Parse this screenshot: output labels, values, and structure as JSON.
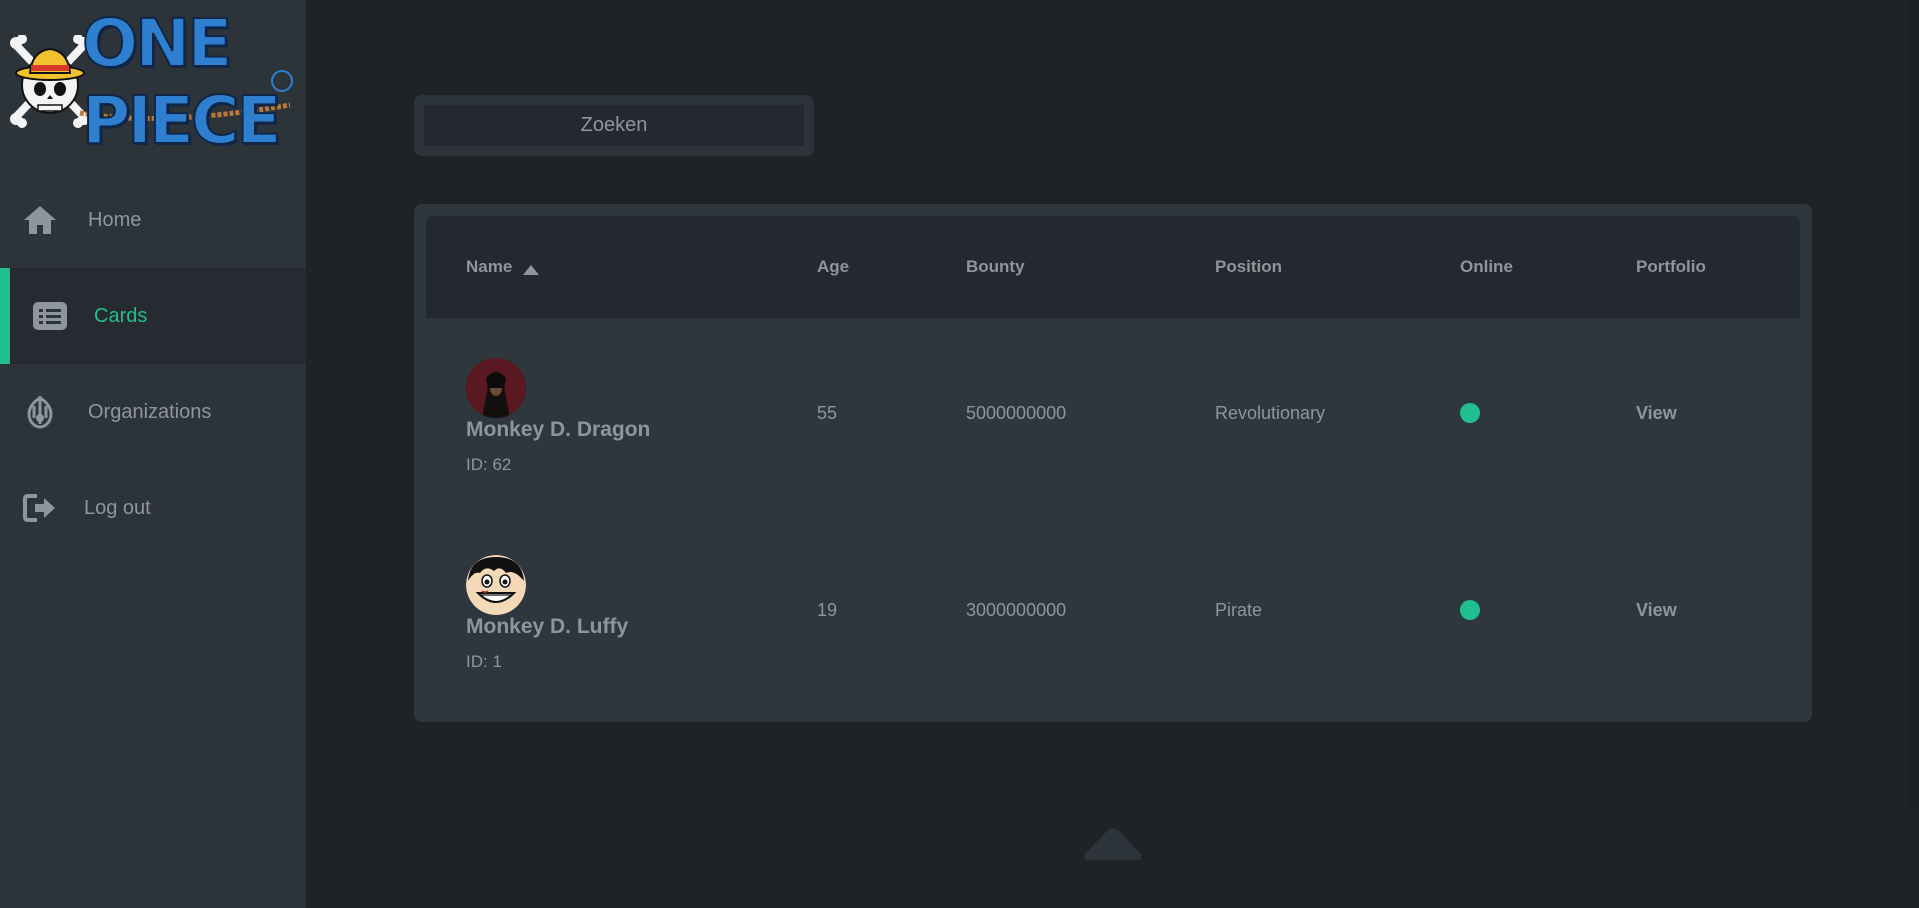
{
  "logo": {
    "wordmark": "ONE PIECE",
    "icon": "straw-hat-skull-logo"
  },
  "sidebar": {
    "items": [
      {
        "label": "Home",
        "icon": "home-icon",
        "active": false
      },
      {
        "label": "Cards",
        "icon": "list-icon",
        "active": true
      },
      {
        "label": "Organizations",
        "icon": "emblem-icon",
        "active": false
      },
      {
        "label": "Log out",
        "icon": "logout-icon",
        "active": false
      }
    ]
  },
  "search": {
    "placeholder": "Zoeken",
    "value": ""
  },
  "table": {
    "columns": {
      "name": "Name",
      "age": "Age",
      "bounty": "Bounty",
      "position": "Position",
      "online": "Online",
      "portfolio": "Portfolio"
    },
    "sort": {
      "column": "name",
      "direction": "asc",
      "icon": "sort-up-icon"
    },
    "rows": [
      {
        "name": "Monkey D. Dragon",
        "id": "ID: 62",
        "age": "55",
        "bounty": "5000000000",
        "position": "Revolutionary",
        "online": true,
        "portfolio": "View",
        "avatar": "dragon-avatar"
      },
      {
        "name": "Monkey D. Luffy",
        "id": "ID: 1",
        "age": "19",
        "bounty": "3000000000",
        "position": "Pirate",
        "online": true,
        "portfolio": "View",
        "avatar": "luffy-avatar"
      }
    ]
  },
  "colors": {
    "accent": "#1fbf8f",
    "sidebar_bg": "#2c3339",
    "page_bg": "#1f2326",
    "text_muted": "#8e969c"
  },
  "scroll_top": {
    "icon": "chevron-up-icon"
  }
}
